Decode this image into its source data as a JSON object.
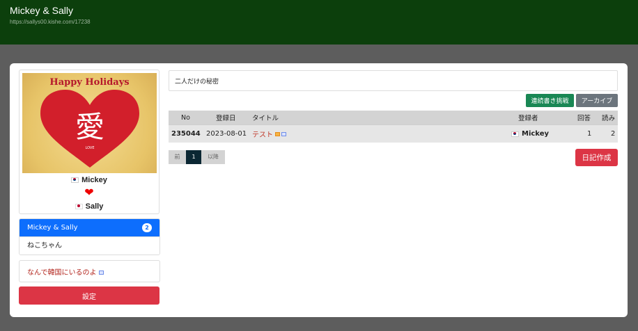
{
  "header": {
    "title": "Mickey & Sally",
    "url": "https://sallys00.kishe.com/17238"
  },
  "profile": {
    "image_title": "Happy Holidays",
    "image_kanji": "愛",
    "image_subtext": "LOVE",
    "name1": "Mickey",
    "name2": "Sally",
    "heart": "❤"
  },
  "groups": [
    {
      "label": "Mickey & Sally",
      "count": "2",
      "active": true
    },
    {
      "label": "ねこちゃん"
    }
  ],
  "sidebar_link": "なんで韓国にいるのよ",
  "settings_label": "設定",
  "description": "二人だけの秘密",
  "buttons": {
    "serial": "連続書き挑戦",
    "archive": "アーカイブ",
    "create": "日記作成"
  },
  "table": {
    "headers": {
      "no": "No",
      "date": "登録日",
      "title": "タイトル",
      "author": "登録者",
      "replies": "回答",
      "reads": "読み"
    },
    "rows": [
      {
        "no": "235044",
        "date": "2023-08-01",
        "title": "テスト",
        "author": "Mickey",
        "replies": "1",
        "reads": "2"
      }
    ]
  },
  "pagination": {
    "prev": "前",
    "current": "1",
    "next": "以降"
  },
  "colors": {
    "header_bg": "#0c3f0c",
    "primary": "#0d6efd",
    "danger": "#dc3545",
    "success": "#198754"
  }
}
